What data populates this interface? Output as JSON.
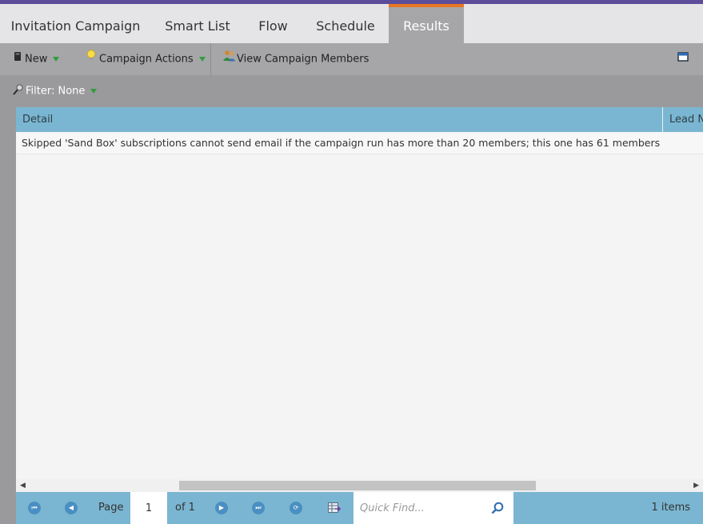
{
  "tabs": [
    {
      "label": "Invitation Campaign"
    },
    {
      "label": "Smart List"
    },
    {
      "label": "Flow"
    },
    {
      "label": "Schedule"
    },
    {
      "label": "Results",
      "active": true
    }
  ],
  "toolbar": {
    "new_label": "New",
    "campaign_actions_label": "Campaign Actions",
    "view_members_label": "View Campaign Members"
  },
  "filter": {
    "label": "Filter: None"
  },
  "grid": {
    "columns": [
      "Detail",
      "Lead N"
    ],
    "rows": [
      {
        "detail": "Skipped 'Sand Box' subscriptions cannot send email if the campaign run has more than 20 members; this one has 61 members"
      }
    ]
  },
  "pager": {
    "page_label": "Page",
    "page_value": "1",
    "of_label": "of 1",
    "quick_find_placeholder": "Quick Find...",
    "items_count": "1 items"
  },
  "colors": {
    "accent": "#5c4d9a",
    "active_tab_border": "#e87722",
    "grid_header": "#7ab6d1",
    "dropdown_arrow": "#2e9e3c"
  }
}
